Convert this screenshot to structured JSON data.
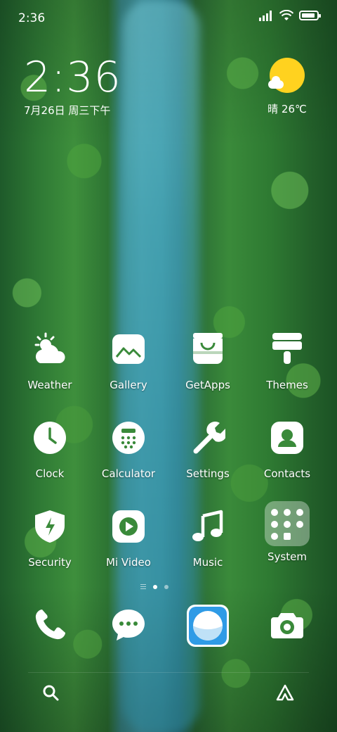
{
  "status_bar": {
    "time": "2:36"
  },
  "clock_widget": {
    "time": "2:36",
    "date": "7月26日 周三下午"
  },
  "weather_widget": {
    "condition_icon": "sun-cloud-icon",
    "text": "晴 26℃",
    "sun_color": "#ffd21f"
  },
  "apps": [
    {
      "label": "Weather",
      "icon": "weather-icon"
    },
    {
      "label": "Gallery",
      "icon": "gallery-icon"
    },
    {
      "label": "GetApps",
      "icon": "getapps-icon"
    },
    {
      "label": "Themes",
      "icon": "themes-icon"
    },
    {
      "label": "Clock",
      "icon": "clock-icon"
    },
    {
      "label": "Calculator",
      "icon": "calculator-icon"
    },
    {
      "label": "Settings",
      "icon": "settings-icon"
    },
    {
      "label": "Contacts",
      "icon": "contacts-icon"
    },
    {
      "label": "Security",
      "icon": "security-icon"
    },
    {
      "label": "Mi Video",
      "icon": "mi-video-icon"
    },
    {
      "label": "Music",
      "icon": "music-icon"
    },
    {
      "label": "System",
      "icon": "system-folder-icon"
    }
  ],
  "dock": [
    {
      "icon": "phone-icon"
    },
    {
      "icon": "messages-icon"
    },
    {
      "icon": "browser-icon"
    },
    {
      "icon": "camera-icon"
    }
  ],
  "page_indicator": {
    "pages": 2,
    "active": 1
  },
  "search_bar": {
    "left_icon": "search-icon",
    "right_icon": "assistant-icon"
  },
  "colors": {
    "browser_accent": "#2f9be6"
  }
}
